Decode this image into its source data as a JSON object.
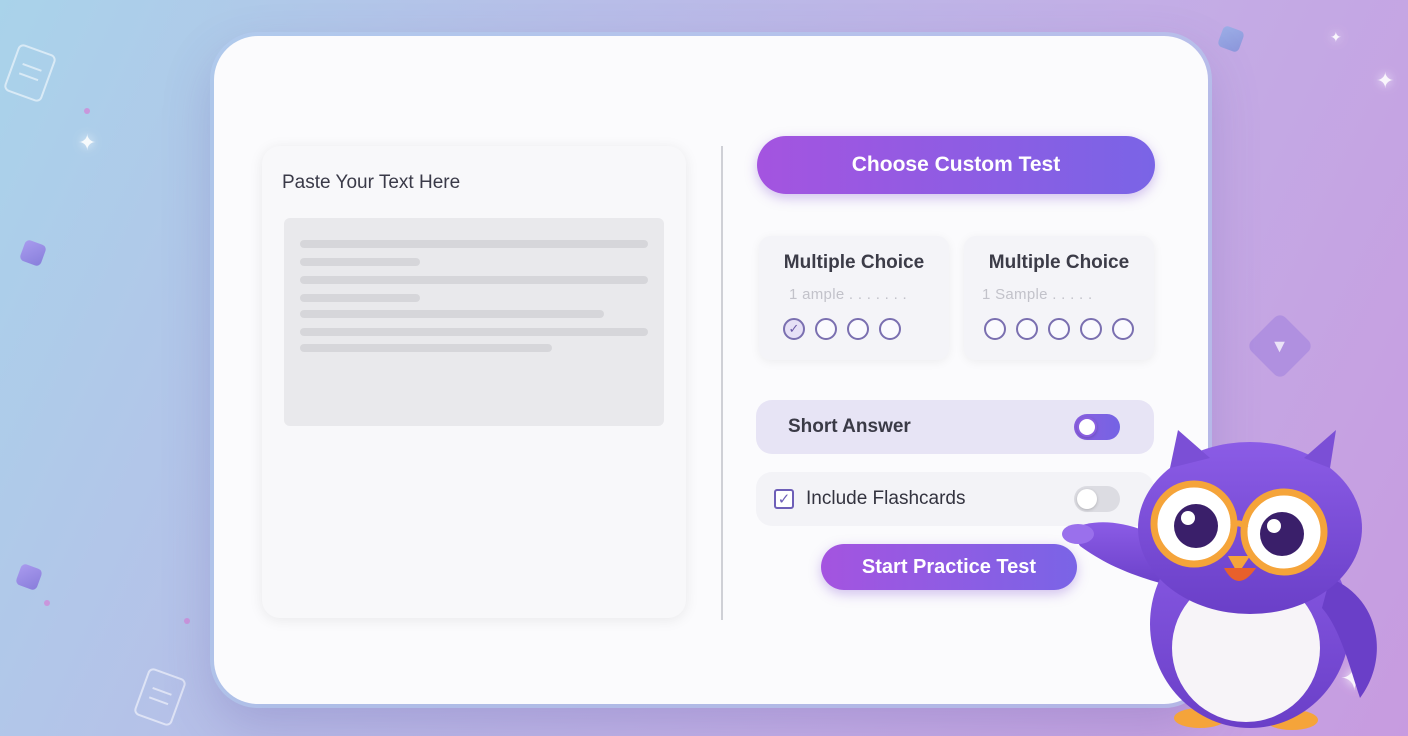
{
  "paste_panel": {
    "title": "Paste Your Text Here"
  },
  "buttons": {
    "choose_custom_test": "Choose Custom Test",
    "start_practice_test": "Start Practice Test"
  },
  "question_types": [
    {
      "title": "Multiple Choice",
      "sample": "1 ample . . . . . . .",
      "options": 4,
      "selected_index": 0
    },
    {
      "title": "Multiple Choice",
      "sample": "1 Sample . . . . .",
      "options": 5,
      "selected_index": -1
    }
  ],
  "short_answer": {
    "label": "Short Answer",
    "enabled": true
  },
  "flashcards": {
    "label": "Include Flashcards",
    "checked": true,
    "toggle_enabled": false
  },
  "colors": {
    "accent_start": "#a454e0",
    "accent_end": "#7a64e6",
    "owl_body": "#7b4fd6"
  }
}
